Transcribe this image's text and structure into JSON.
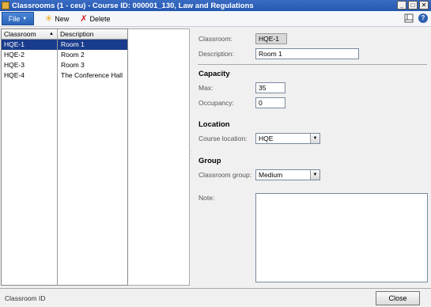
{
  "window": {
    "title": "Classrooms (1 - ceu) - Course ID: 000001_130, Law and Regulations",
    "controls": [
      "minimize",
      "maximize",
      "close"
    ]
  },
  "toolbar": {
    "file_label": "File",
    "new_label": "New",
    "delete_label": "Delete",
    "right_icons": [
      "layout-icon",
      "help-icon"
    ]
  },
  "grid": {
    "columns": [
      "Classroom",
      "Description"
    ],
    "rows": [
      {
        "classroom": "HQE-1",
        "description": "Room 1",
        "selected": true
      },
      {
        "classroom": "HQE-2",
        "description": "Room 2",
        "selected": false
      },
      {
        "classroom": "HQE-3",
        "description": "Room 3",
        "selected": false
      },
      {
        "classroom": "HQE-4",
        "description": "The Conference Hall",
        "selected": false
      }
    ]
  },
  "form": {
    "classroom_label": "Classroom:",
    "classroom_value": "HQE-1",
    "description_label": "Description:",
    "description_value": "Room 1",
    "capacity_title": "Capacity",
    "max_label": "Max:",
    "max_value": "35",
    "occupancy_label": "Occupancy:",
    "occupancy_value": "0",
    "location_title": "Location",
    "course_location_label": "Course location:",
    "course_location_value": "HQE",
    "group_title": "Group",
    "classroom_group_label": "Classroom group:",
    "classroom_group_value": "Medium",
    "note_label": "Note:",
    "note_value": ""
  },
  "status": {
    "text": "Classroom ID",
    "close_label": "Close"
  },
  "colors": {
    "titlebar": "#2457b0",
    "selected_row": "#1a3c8c",
    "file_button": "#2b64b8"
  }
}
